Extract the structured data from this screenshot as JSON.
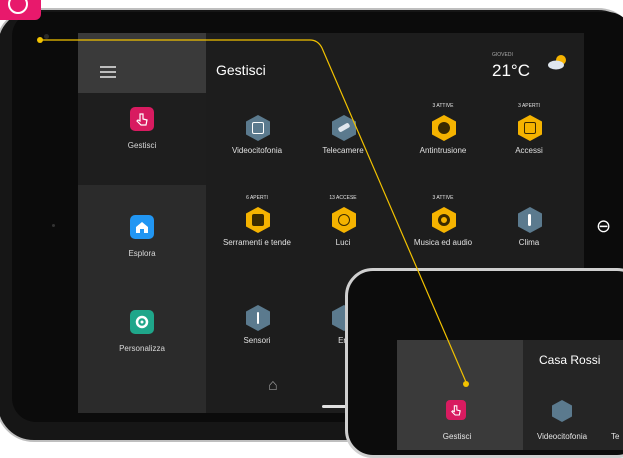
{
  "screen": {
    "title": "Gestisci",
    "weather": {
      "day": "GIOVEDI",
      "temperature": "21°C",
      "icon": "partly-cloudy-icon"
    },
    "sidebar": {
      "menu_icon": "hamburger-icon",
      "items": [
        {
          "label": "Gestisci",
          "icon": "hand-tap-icon",
          "color": "#d81b60",
          "active": true
        },
        {
          "label": "Esplora",
          "icon": "home-icon",
          "color": "#2196f3",
          "active": false
        },
        {
          "label": "Personalizza",
          "icon": "gear-icon",
          "color": "#1fa68a",
          "active": false
        }
      ]
    },
    "tiles": [
      {
        "badge": "",
        "label": "Videocitofonia",
        "color": "#5b7a8e",
        "icon": "intercom-icon"
      },
      {
        "badge": "",
        "label": "Telecamere",
        "color": "#5b7a8e",
        "icon": "camera-icon"
      },
      {
        "badge": "3 ATTIVE",
        "label": "Antintrusione",
        "color": "#f5b300",
        "icon": "alarm-icon"
      },
      {
        "badge": "3 APERTI",
        "label": "Accessi",
        "color": "#f5b300",
        "icon": "door-icon"
      },
      {
        "badge": "6 APERTI",
        "label": "Serramenti e tende",
        "color": "#f5b300",
        "icon": "shutter-icon"
      },
      {
        "badge": "13 ACCESE",
        "label": "Luci",
        "color": "#f5b300",
        "icon": "light-icon"
      },
      {
        "badge": "3 ATTIVE",
        "label": "Musica ed audio",
        "color": "#f5b300",
        "icon": "speaker-icon"
      },
      {
        "badge": "",
        "label": "Clima",
        "color": "#5b7a8e",
        "icon": "thermometer-icon"
      },
      {
        "badge": "",
        "label": "Sensori",
        "color": "#5b7a8e",
        "icon": "sensor-icon"
      },
      {
        "badge": "",
        "label": "En",
        "color": "#5b7a8e",
        "icon": "energy-icon"
      }
    ],
    "home_icon": "home-outline-icon"
  },
  "phone": {
    "title": "Casa Rossi",
    "sidebar_label": "Gestisci",
    "tile_label": "Videocitofonia",
    "tile_partial_label": "Te"
  },
  "colors": {
    "accent": "#e8196c",
    "callout_line": "#f2c200"
  }
}
